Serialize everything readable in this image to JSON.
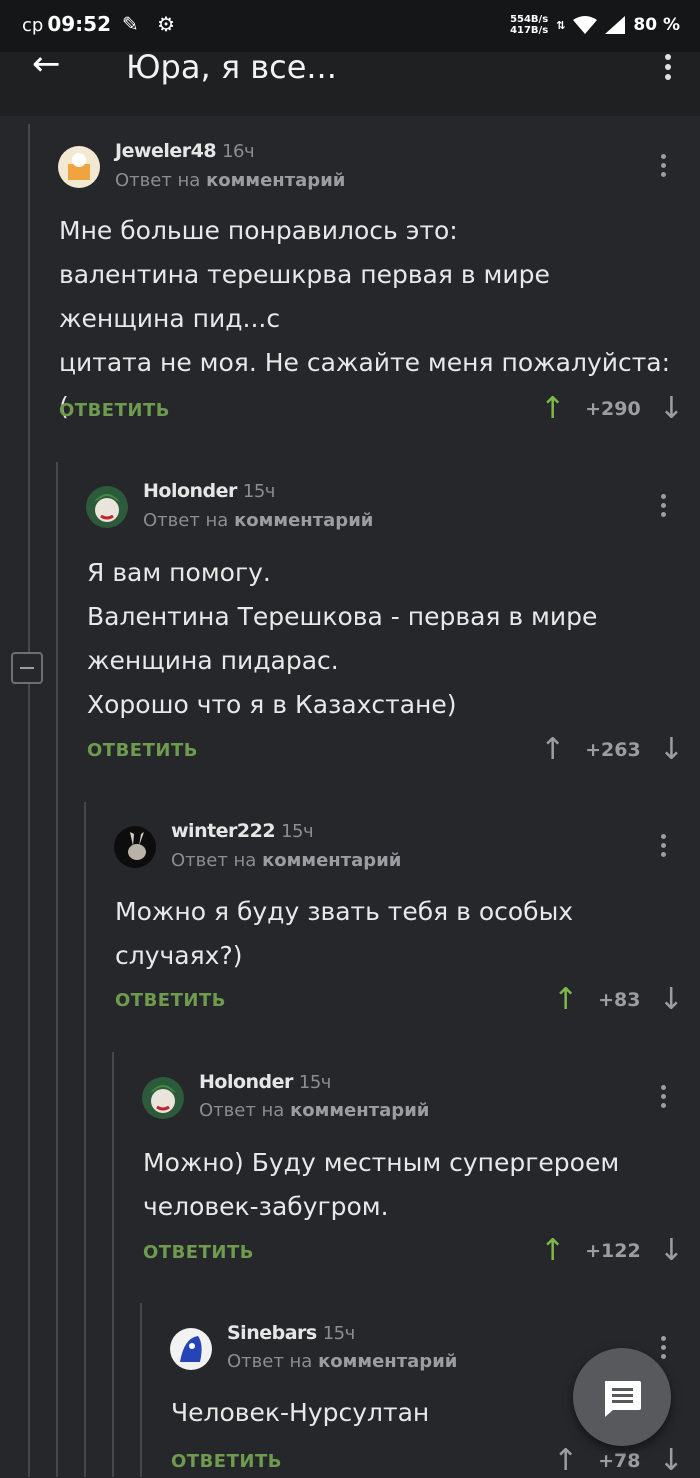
{
  "status_bar": {
    "day": "ср",
    "time": "09:52",
    "net_up": "554B/s",
    "net_down": "417B/s",
    "battery": "80 %"
  },
  "header": {
    "title": "Юра, я все..."
  },
  "comments": [
    {
      "user": "Jeweler48",
      "time": "16ч",
      "reply_to_prefix": "Ответ на",
      "reply_to_link": "комментарий",
      "text": "Мне больше понравилось это:\nвалентина терешкрва первая в мире женщина пид...с\nцитата не моя. Не сажайте меня пожалуйста:(",
      "reply_label": "ОТВЕТИТЬ",
      "rating": "+290",
      "upvoted": true
    },
    {
      "user": "Holonder",
      "time": "15ч",
      "reply_to_prefix": "Ответ на",
      "reply_to_link": "комментарий",
      "text": "Я вам помогу.\nВалентина Терешкова - первая в мире женщина пидарас.\nХорошо что я в Казахстане)",
      "reply_label": "ОТВЕТИТЬ",
      "rating": "+263",
      "upvoted": false
    },
    {
      "user": "winter222",
      "time": "15ч",
      "reply_to_prefix": "Ответ на",
      "reply_to_link": "комментарий",
      "text": "Можно я буду звать тебя в особых случаях?)",
      "reply_label": "ОТВЕТИТЬ",
      "rating": "+83",
      "upvoted": true
    },
    {
      "user": "Holonder",
      "time": "15ч",
      "reply_to_prefix": "Ответ на",
      "reply_to_link": "комментарий",
      "text": "Можно) Буду местным супергероем человек-забугром.",
      "reply_label": "ОТВЕТИТЬ",
      "rating": "+122",
      "upvoted": true
    },
    {
      "user": "Sinebars",
      "time": "15ч",
      "reply_to_prefix": "Ответ на",
      "reply_to_link": "комментарий",
      "text": "Человек-Нурсултан",
      "reply_label": "ОТВЕТИТЬ",
      "rating": "+78",
      "upvoted": false
    }
  ],
  "colors": {
    "background": "#25272a",
    "accent_green": "#6f9b4e",
    "upvote_active": "#7fb84a"
  }
}
